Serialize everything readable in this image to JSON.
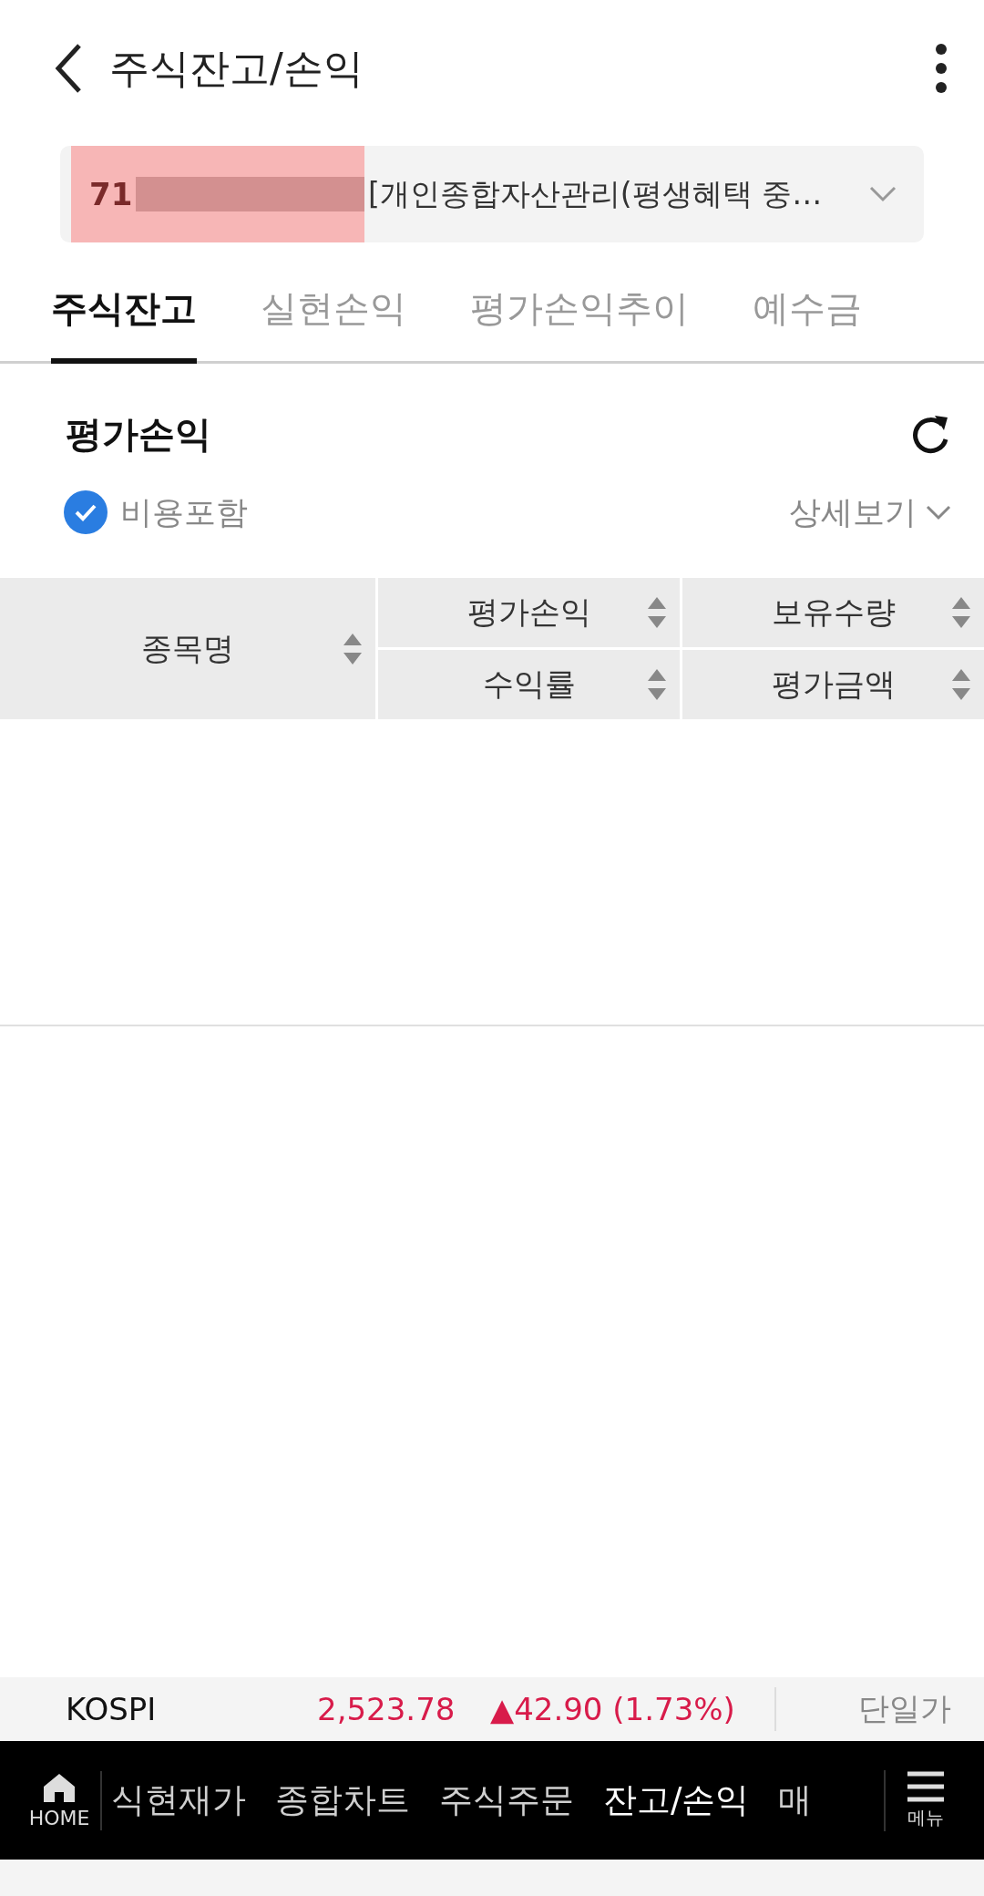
{
  "header": {
    "title": "주식잔고/손익"
  },
  "account": {
    "number_prefix": "71",
    "name": "[개인종합자산관리(평생혜택 중…"
  },
  "tabs": [
    {
      "label": "주식잔고",
      "selected": true
    },
    {
      "label": "실현손익",
      "selected": false
    },
    {
      "label": "평가손익추이",
      "selected": false
    },
    {
      "label": "예수금",
      "selected": false
    }
  ],
  "section": {
    "title": "평가손익",
    "include_fees": {
      "label": "비용포함",
      "checked": true
    },
    "detail_link": "상세보기"
  },
  "table": {
    "columns": [
      {
        "label": "종목명"
      },
      {
        "label": "평가손익"
      },
      {
        "label": "보유수량"
      },
      {
        "label": "수익률"
      },
      {
        "label": "평가금액"
      }
    ]
  },
  "ticker": {
    "index": "KOSPI",
    "value": "2,523.78",
    "change": "▲42.90",
    "percent": "(1.73%)",
    "mode": "단일가"
  },
  "bottom_nav": {
    "home": "HOME",
    "items": [
      {
        "label": "식현재가",
        "selected": false
      },
      {
        "label": "종합차트",
        "selected": false
      },
      {
        "label": "주식주문",
        "selected": false
      },
      {
        "label": "잔고/손익",
        "selected": true
      },
      {
        "label": "매",
        "selected": false
      }
    ],
    "menu": "메뉴"
  }
}
